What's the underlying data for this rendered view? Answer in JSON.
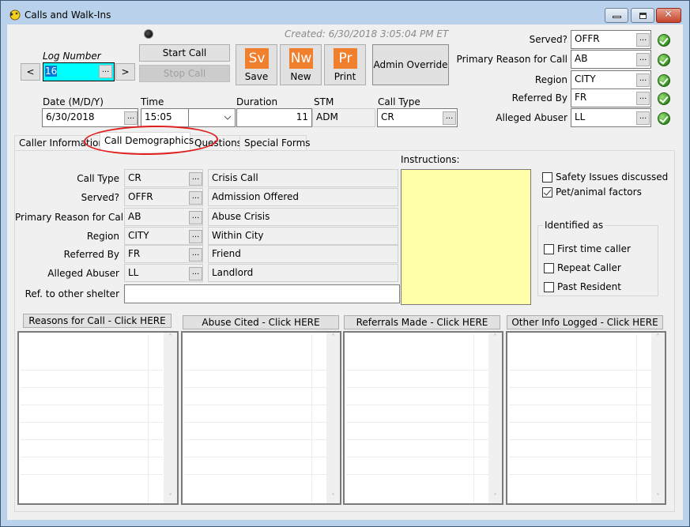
{
  "window": {
    "title": "Calls and Walk-Ins",
    "controls": {
      "minimize": "minimize",
      "maximize": "maximize",
      "close": "✕"
    }
  },
  "header": {
    "created_text": "Created: 6/30/2018 3:05:04 PM ET",
    "log_number_label": "Log Number",
    "log_number_value": "16",
    "prev_label": "<",
    "next_label": ">",
    "ellipsis": "...",
    "start_call_label": "Start Call",
    "stop_call_label": "Stop Call",
    "save": {
      "icon_text": "Sv",
      "label": "Save"
    },
    "new": {
      "icon_text": "Nw",
      "label": "New"
    },
    "print": {
      "icon_text": "Pr",
      "label": "Print"
    },
    "admin_override_label": "Admin Override",
    "accent_color": "#f07f2e",
    "log_number_highlight": "#00ffff"
  },
  "call_fields": {
    "date_label": "Date (M/D/Y)",
    "date_value": "6/30/2018",
    "time_label": "Time",
    "time_value": "15:05",
    "time_dropdown_value": "",
    "duration_label": "Duration",
    "duration_value": "11",
    "stm_label": "STM",
    "stm_value": "ADM",
    "call_type_label": "Call Type",
    "call_type_value": "CR"
  },
  "right_panel": {
    "rows": [
      {
        "label": "Served?",
        "value": "OFFR",
        "status": "valid"
      },
      {
        "label": "Primary Reason for Call",
        "value": "AB",
        "status": "valid"
      },
      {
        "label": "Region",
        "value": "CITY",
        "status": "valid"
      },
      {
        "label": "Referred By",
        "value": "FR",
        "status": "valid"
      },
      {
        "label": "Alleged Abuser",
        "value": "LL",
        "status": "valid"
      }
    ]
  },
  "tabs": [
    {
      "label": "Caller Information",
      "active": false
    },
    {
      "label": "Call Demographics",
      "active": true
    },
    {
      "label": "Questions",
      "active": false
    },
    {
      "label": "Special Forms",
      "active": false
    }
  ],
  "demographics": {
    "rows": [
      {
        "label": "Call Type",
        "code": "CR",
        "description": "Crisis Call"
      },
      {
        "label": "Served?",
        "code": "OFFR",
        "description": "Admission Offered"
      },
      {
        "label": "Primary Reason for Call",
        "code": "AB",
        "description": "Abuse Crisis"
      },
      {
        "label": "Region",
        "code": "CITY",
        "description": "Within City"
      },
      {
        "label": "Referred By",
        "code": "FR",
        "description": "Friend"
      },
      {
        "label": "Alleged Abuser",
        "code": "LL",
        "description": "Landlord"
      }
    ],
    "ref_other_shelter_label": "Ref. to other shelter",
    "ref_other_shelter_value": "",
    "instructions_label": "Instructions:",
    "instructions_value": "",
    "instructions_color": "#ffffaa",
    "checkboxes": [
      {
        "label": "Safety Issues discussed",
        "checked": false
      },
      {
        "label": "Pet/animal factors",
        "checked": true
      }
    ],
    "identified_as": {
      "legend": "Identified as",
      "options": [
        {
          "label": "First time caller",
          "checked": false
        },
        {
          "label": "Repeat Caller",
          "checked": false
        },
        {
          "label": "Past Resident",
          "checked": false
        }
      ]
    }
  },
  "lists": [
    {
      "header": "Reasons for Call - Click HERE",
      "items": []
    },
    {
      "header": "Abuse Cited - Click HERE",
      "items": []
    },
    {
      "header": "Referrals Made - Click HERE",
      "items": []
    },
    {
      "header": "Other Info Logged - Click HERE",
      "items": []
    }
  ],
  "scroll": {
    "up": "˄",
    "down": "˅"
  }
}
